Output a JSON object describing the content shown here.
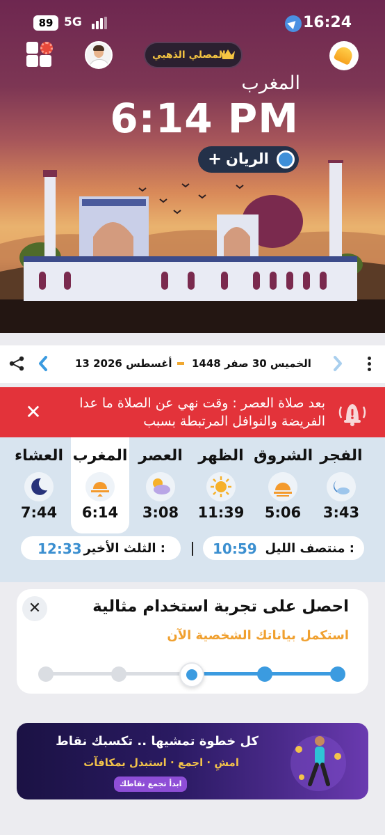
{
  "status_bar": {
    "time": "16:24",
    "battery": "89",
    "network": "5G"
  },
  "header": {
    "gold_badge": "المصلي الذهبي"
  },
  "current_prayer": {
    "name": "المغرب",
    "time": "6:14 PM"
  },
  "location": {
    "name": "الريان",
    "add": "+"
  },
  "date_bar": {
    "hijri": "الخميس 30 صفر 1448",
    "gregorian": "13 أغسطس 2026"
  },
  "alert": {
    "line1": "بعد صلاة العصر : وقت نهي عن الصلاة ما عدا",
    "line2": "الفريضة والنوافل المرتبطة بسبب",
    "close": "✕"
  },
  "prayers": [
    {
      "name": "الفجر",
      "time": "3:43",
      "icon": "cloud-moon-icon"
    },
    {
      "name": "الشروق",
      "time": "5:06",
      "icon": "sunrise-icon"
    },
    {
      "name": "الظهر",
      "time": "11:39",
      "icon": "sun-icon"
    },
    {
      "name": "العصر",
      "time": "3:08",
      "icon": "cloud-sun-icon"
    },
    {
      "name": "المغرب",
      "time": "6:14",
      "icon": "sunset-icon",
      "active": true
    },
    {
      "name": "العشاء",
      "time": "7:44",
      "icon": "moon-icon"
    }
  ],
  "night": {
    "midnight_label": "منتصف الليل :",
    "midnight_time": "10:59",
    "last_third_label": "الثلث الأخير :",
    "last_third_time": "12:33"
  },
  "onboarding": {
    "title": "احصل على تجربة استخدام مثالية",
    "subtitle": "استكمل بياناتك الشخصية الآن",
    "close": "✕",
    "steps_total": 5,
    "steps_completed": 2
  },
  "banner": {
    "headline": "كل خطوة تمشيها .. تكسبك نقاط",
    "subline": "امشِ · اجمع · استبدل بمكافآت",
    "cta": "ابدأ تجمع نقاطك"
  },
  "colors": {
    "accent": "#3b9be0",
    "alert": "#e3333a",
    "gold": "#f5c542",
    "orange": "#f0a02f"
  }
}
